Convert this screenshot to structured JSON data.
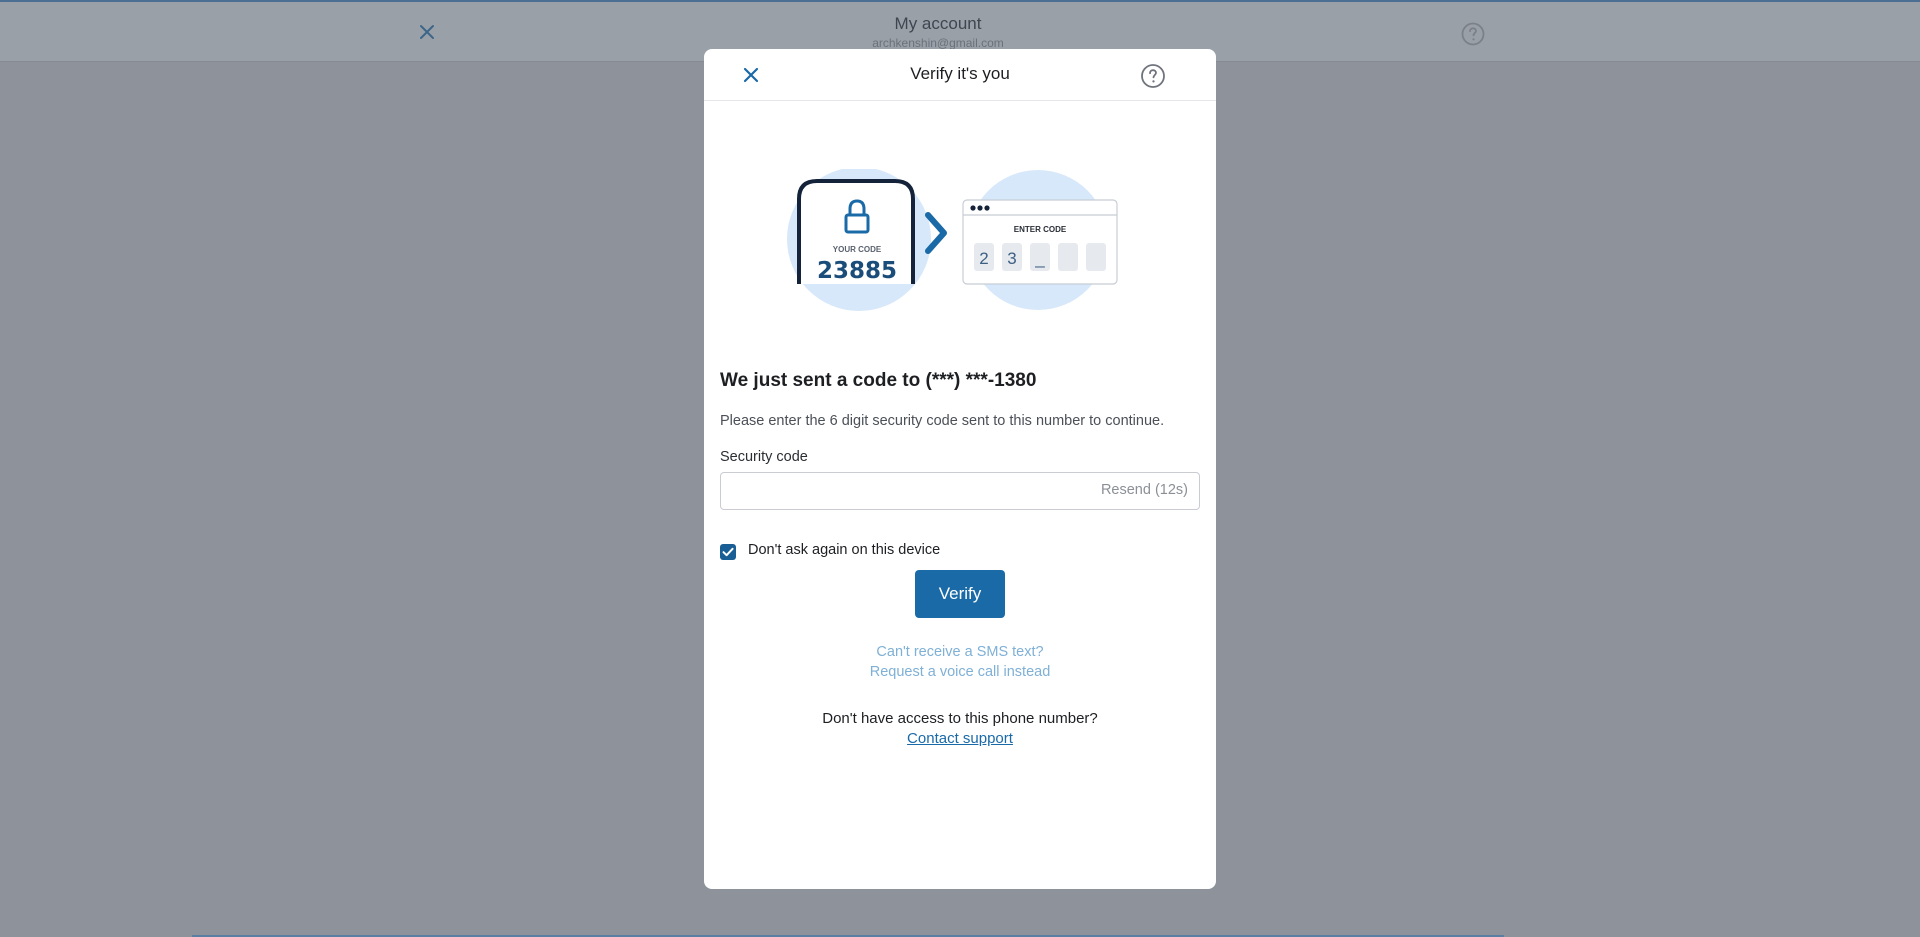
{
  "background": {
    "title": "My account",
    "email": "archkenshin@gmail.com"
  },
  "modal": {
    "title": "Verify it's you",
    "illustration": {
      "phone_caption": "YOUR CODE",
      "phone_code": "23885",
      "panel_caption": "ENTER CODE",
      "entered_digits": [
        "2",
        "3",
        "_",
        "",
        ""
      ]
    },
    "heading": "We just sent a code to (***) ***-1380",
    "description": "Please enter the 6 digit security code sent to this number to continue.",
    "field_label": "Security code",
    "field_value": "",
    "resend_label": "Resend (12s)",
    "remember_label": "Don't ask again on this device",
    "remember_checked": true,
    "verify_label": "Verify",
    "sms_question": "Can't receive a SMS text?",
    "voice_call_link": "Request a voice call instead",
    "no_access_text": "Don't have access to this phone number?",
    "contact_support_link": "Contact support"
  },
  "colors": {
    "accent": "#1a6aa8",
    "overlay": "#8d929b",
    "light_link": "#7fb0d6"
  },
  "icons": {
    "close": "close-icon",
    "help": "help-circle-icon",
    "lock": "lock-icon",
    "chevron": "chevron-right-icon",
    "check": "check-icon"
  }
}
